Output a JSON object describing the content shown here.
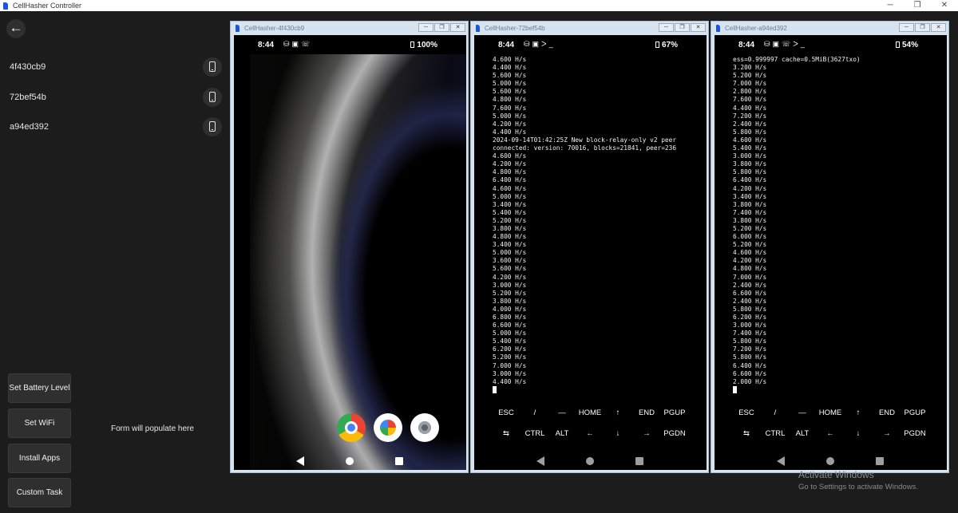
{
  "app": {
    "title": "CellHasher Controller",
    "win_min": "─",
    "win_max": "❐",
    "win_close": "✕"
  },
  "sidebar": {
    "back_icon": "←",
    "devices": [
      {
        "id": "4f430cb9"
      },
      {
        "id": "72bef54b"
      },
      {
        "id": "a94ed392"
      }
    ],
    "actions": [
      "Set Battery Level",
      "Set WiFi",
      "Install Apps",
      "Custom Task"
    ],
    "form_hint": "Form will populate here"
  },
  "windows": [
    {
      "title": "CellHasher-4f430cb9",
      "status": {
        "time": "8:44",
        "battery": "100%"
      },
      "screen": "home",
      "apps": [
        "chrome-icon",
        "photos-icon",
        "camera-icon"
      ]
    },
    {
      "title": "CellHasher-72bef54b",
      "status": {
        "time": "8:44",
        "battery": "67%"
      },
      "screen": "terminal",
      "terminal": "4.600 H/s\n4.400 H/s\n5.600 H/s\n5.000 H/s\n5.600 H/s\n4.800 H/s\n7.600 H/s\n5.000 H/s\n4.200 H/s\n4.400 H/s\n2024-09-14T01:42:25Z New block-relay-only v2 peer\nconnected: version: 70016, blocks=21841, peer=236\n4.600 H/s\n4.200 H/s\n4.800 H/s\n6.400 H/s\n4.600 H/s\n5.000 H/s\n3.400 H/s\n5.400 H/s\n5.200 H/s\n3.800 H/s\n4.800 H/s\n3.400 H/s\n5.000 H/s\n3.600 H/s\n5.600 H/s\n4.200 H/s\n3.000 H/s\n5.200 H/s\n3.800 H/s\n4.000 H/s\n6.800 H/s\n6.600 H/s\n5.000 H/s\n5.400 H/s\n6.200 H/s\n5.200 H/s\n7.000 H/s\n3.000 H/s\n4.400 H/s"
    },
    {
      "title": "CellHasher-a94ed392",
      "status": {
        "time": "8:44",
        "battery": "54%"
      },
      "screen": "terminal",
      "terminal": "ess=0.999997 cache=0.5MiB(3627txo)\n3.200 H/s\n5.200 H/s\n7.000 H/s\n2.800 H/s\n7.600 H/s\n4.400 H/s\n7.200 H/s\n2.400 H/s\n5.800 H/s\n4.600 H/s\n5.400 H/s\n3.000 H/s\n3.800 H/s\n5.800 H/s\n6.400 H/s\n4.200 H/s\n3.400 H/s\n3.800 H/s\n7.400 H/s\n3.800 H/s\n5.200 H/s\n6.000 H/s\n5.200 H/s\n4.600 H/s\n4.200 H/s\n4.800 H/s\n7.000 H/s\n2.400 H/s\n6.600 H/s\n2.400 H/s\n5.800 H/s\n6.200 H/s\n3.000 H/s\n7.400 H/s\n5.800 H/s\n7.200 H/s\n5.800 H/s\n6.400 H/s\n6.600 H/s\n2.000 H/s"
    }
  ],
  "terminal_keys": {
    "row1": [
      "ESC",
      "/",
      "—",
      "HOME",
      "↑",
      "END",
      "PGUP"
    ],
    "row2": [
      "⇆",
      "CTRL",
      "ALT",
      "←",
      "↓",
      "→",
      "PGDN"
    ]
  },
  "activation": {
    "title": "Activate Windows",
    "subtitle": "Go to Settings to activate Windows."
  }
}
